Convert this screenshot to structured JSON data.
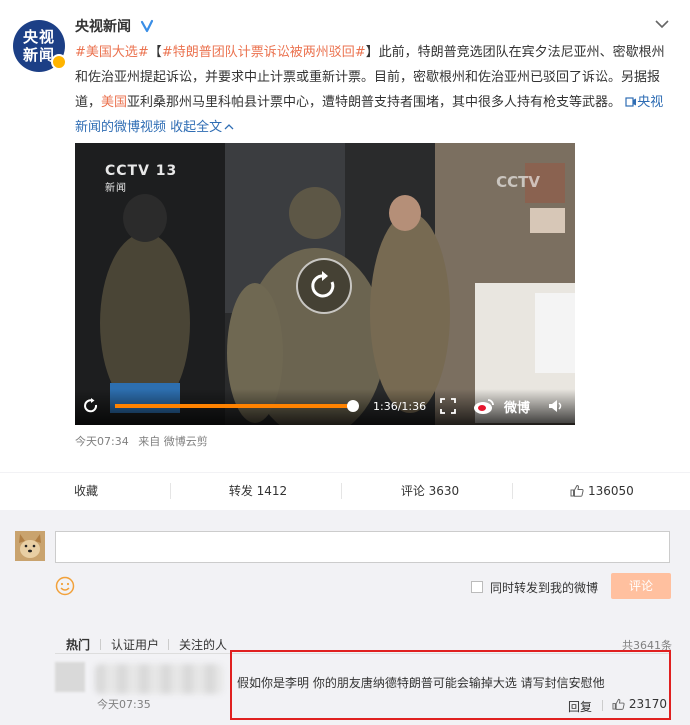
{
  "post": {
    "author": "央视新闻",
    "avatar_text": "央视新闻",
    "text": {
      "tag1": "#美国大选#",
      "bracket_open": "【",
      "tag2": "#特朗普团队计票诉讼被两州驳回#",
      "bracket_close": "】",
      "body1": "此前，特朗普竞选团队在宾夕法尼亚州、密歇根州和佐治亚州提起诉讼，并要求中止计票或重新计票。目前，密歇根州和佐治亚州已驳回了诉讼。另据报道，",
      "country": "美国",
      "body2": "亚利桑那州马里科帕县计票中心，遭特朗普支持者围堵，其中很多人持有枪支等武器。",
      "video_link": "央视新闻的微博视频",
      "collapse": "收起全文"
    },
    "video": {
      "time": "1:36/1:36",
      "progress": 1.0,
      "watermark_cctv": "CCTV 13",
      "watermark_news": "新闻",
      "watermark_cctv2": "CCTV",
      "weibo": "微博"
    },
    "meta": {
      "time": "今天07:34",
      "from": "来自 微博云剪"
    }
  },
  "actions": {
    "favorite": "收藏",
    "repost": "转发 1412",
    "comment": "评论 3630",
    "like": "136050"
  },
  "composer": {
    "checkbox_label": "同时转发到我的微博",
    "submit": "评论"
  },
  "comments": {
    "tabs": [
      "热门",
      "认证用户",
      "关注的人"
    ],
    "total": "共3641条",
    "items": [
      {
        "time": "今天07:35",
        "text": "假如你是李明 你的朋友唐纳德特朗普可能会输掉大选 请写封信安慰他",
        "reply": "回复",
        "likes": "23170"
      }
    ]
  },
  "colors": {
    "accent": "#eb7350",
    "link_blue": "#2f6db4",
    "highlight": "#e02020",
    "progress": "#ff8200"
  }
}
